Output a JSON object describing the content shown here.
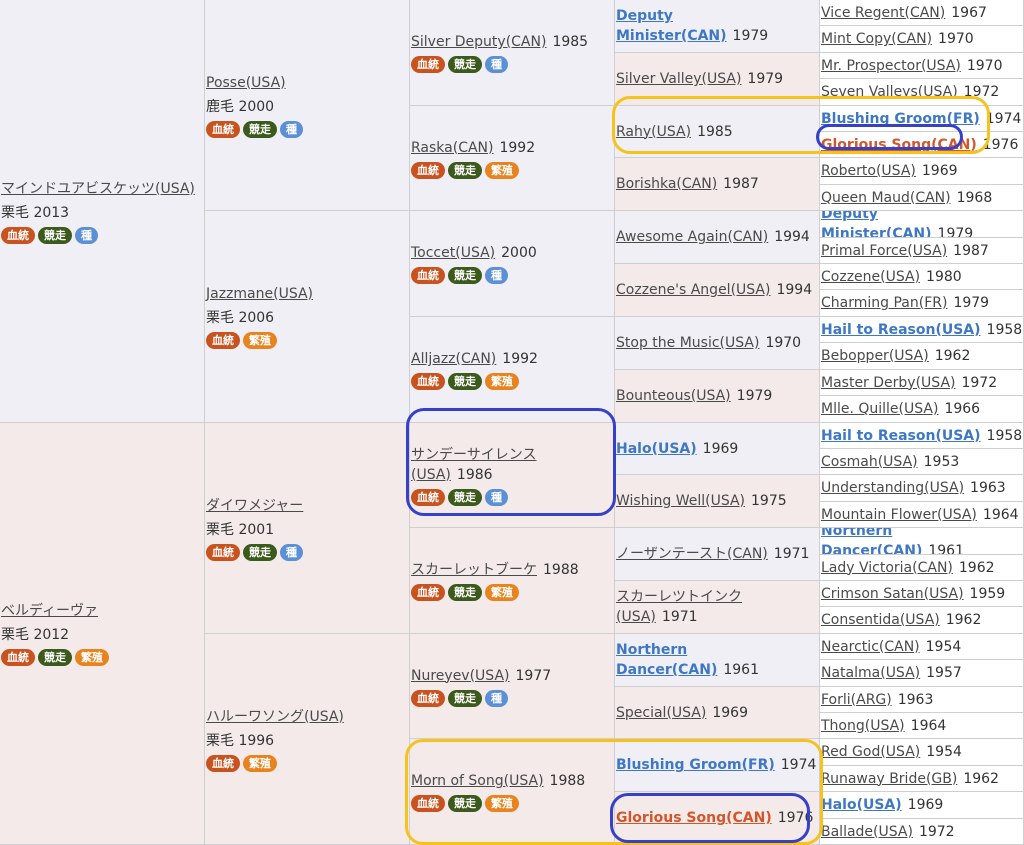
{
  "badges": {
    "blood": "血統",
    "race": "競走",
    "stud": "種",
    "breed": "繁殖"
  },
  "gen1": [
    {
      "name": "マインドユアビスケッツ(USA)",
      "coat": "栗毛 2013",
      "badges": [
        "blood",
        "race",
        "stud"
      ]
    },
    {
      "name": "ベルディーヴァ",
      "coat": "栗毛 2012",
      "badges": [
        "blood",
        "race",
        "breed"
      ]
    }
  ],
  "gen2": [
    {
      "name": "Posse(USA)",
      "coat": "鹿毛 2000",
      "badges": [
        "blood",
        "race",
        "stud"
      ]
    },
    {
      "name": "Jazzmane(USA)",
      "coat": "栗毛 2006",
      "badges": [
        "blood",
        "breed"
      ]
    },
    {
      "name": "ダイワメジャー",
      "coat": "栗毛 2001",
      "badges": [
        "blood",
        "race",
        "stud"
      ]
    },
    {
      "name": "ハルーワソング(USA)",
      "coat": "栗毛 1996",
      "badges": [
        "blood",
        "breed"
      ]
    }
  ],
  "gen3": [
    {
      "name": "Silver Deputy(CAN)",
      "year": "1985",
      "badges": [
        "blood",
        "race",
        "stud"
      ]
    },
    {
      "name": "Raska(CAN)",
      "year": "1992",
      "badges": [
        "blood",
        "race",
        "breed"
      ]
    },
    {
      "name": "Toccet(USA)",
      "year": "2000",
      "badges": [
        "blood",
        "race",
        "stud"
      ]
    },
    {
      "name": "Alljazz(CAN)",
      "year": "1992",
      "badges": [
        "blood",
        "race",
        "breed"
      ]
    },
    {
      "name": "サンデーサイレンス(USA)",
      "year": "1986",
      "badges": [
        "blood",
        "race",
        "stud"
      ]
    },
    {
      "name": "スカーレットブーケ",
      "year": "1988",
      "badges": [
        "blood",
        "race",
        "breed"
      ]
    },
    {
      "name": "Nureyev(USA)",
      "year": "1977",
      "badges": [
        "blood",
        "race",
        "stud"
      ]
    },
    {
      "name": "Morn of Song(USA)",
      "year": "1988",
      "badges": [
        "blood",
        "race",
        "breed"
      ]
    }
  ],
  "gen4": [
    {
      "name": "Deputy Minister(CAN)",
      "year": "1979",
      "style": "bold"
    },
    {
      "name": "Silver Valley(USA)",
      "year": "1979",
      "style": ""
    },
    {
      "name": "Rahy(USA)",
      "year": "1985",
      "style": ""
    },
    {
      "name": "Borishka(CAN)",
      "year": "1987",
      "style": ""
    },
    {
      "name": "Awesome Again(CAN)",
      "year": "1994",
      "style": ""
    },
    {
      "name": "Cozzene's Angel(USA)",
      "year": "1994",
      "style": ""
    },
    {
      "name": "Stop the Music(USA)",
      "year": "1970",
      "style": ""
    },
    {
      "name": "Bounteous(USA)",
      "year": "1979",
      "style": ""
    },
    {
      "name": "Halo(USA)",
      "year": "1969",
      "style": "bold"
    },
    {
      "name": "Wishing Well(USA)",
      "year": "1975",
      "style": ""
    },
    {
      "name": "ノーザンテースト(CAN)",
      "year": "1971",
      "style": ""
    },
    {
      "name": "スカーレツトインク(USA)",
      "year": "1971",
      "style": ""
    },
    {
      "name": "Northern Dancer(CAN)",
      "year": "1961",
      "style": "bold"
    },
    {
      "name": "Special(USA)",
      "year": "1969",
      "style": ""
    },
    {
      "name": "Blushing Groom(FR)",
      "year": "1974",
      "style": "bold"
    },
    {
      "name": "Glorious Song(CAN)",
      "year": "1976",
      "style": "red"
    }
  ],
  "gen5": [
    {
      "name": "Vice Regent(CAN)",
      "year": "1967",
      "style": ""
    },
    {
      "name": "Mint Copy(CAN)",
      "year": "1970",
      "style": ""
    },
    {
      "name": "Mr. Prospector(USA)",
      "year": "1970",
      "style": ""
    },
    {
      "name": "Seven Valleys(USA)",
      "year": "1972",
      "style": ""
    },
    {
      "name": "Blushing Groom(FR)",
      "year": "1974",
      "style": "bold"
    },
    {
      "name": "Glorious Song(CAN)",
      "year": "1976",
      "style": "red"
    },
    {
      "name": "Roberto(USA)",
      "year": "1969",
      "style": ""
    },
    {
      "name": "Queen Maud(CAN)",
      "year": "1968",
      "style": ""
    },
    {
      "name": "Deputy Minister(CAN)",
      "year": "1979",
      "style": "bold"
    },
    {
      "name": "Primal Force(USA)",
      "year": "1987",
      "style": ""
    },
    {
      "name": "Cozzene(USA)",
      "year": "1980",
      "style": ""
    },
    {
      "name": "Charming Pan(FR)",
      "year": "1979",
      "style": ""
    },
    {
      "name": "Hail to Reason(USA)",
      "year": "1958",
      "style": "bold"
    },
    {
      "name": "Bebopper(USA)",
      "year": "1962",
      "style": ""
    },
    {
      "name": "Master Derby(USA)",
      "year": "1972",
      "style": ""
    },
    {
      "name": "Mlle. Quille(USA)",
      "year": "1966",
      "style": ""
    },
    {
      "name": "Hail to Reason(USA)",
      "year": "1958",
      "style": "bold"
    },
    {
      "name": "Cosmah(USA)",
      "year": "1953",
      "style": ""
    },
    {
      "name": "Understanding(USA)",
      "year": "1963",
      "style": ""
    },
    {
      "name": "Mountain Flower(USA)",
      "year": "1964",
      "style": ""
    },
    {
      "name": "Northern Dancer(CAN)",
      "year": "1961",
      "style": "bold"
    },
    {
      "name": "Lady Victoria(CAN)",
      "year": "1962",
      "style": ""
    },
    {
      "name": "Crimson Satan(USA)",
      "year": "1959",
      "style": ""
    },
    {
      "name": "Consentida(USA)",
      "year": "1962",
      "style": ""
    },
    {
      "name": "Nearctic(CAN)",
      "year": "1954",
      "style": ""
    },
    {
      "name": "Natalma(USA)",
      "year": "1957",
      "style": ""
    },
    {
      "name": "Forli(ARG)",
      "year": "1963",
      "style": ""
    },
    {
      "name": "Thong(USA)",
      "year": "1964",
      "style": ""
    },
    {
      "name": "Red God(USA)",
      "year": "1954",
      "style": ""
    },
    {
      "name": "Runaway Bride(GB)",
      "year": "1962",
      "style": ""
    },
    {
      "name": "Halo(USA)",
      "year": "1969",
      "style": "bold"
    },
    {
      "name": "Ballade(USA)",
      "year": "1972",
      "style": ""
    }
  ]
}
